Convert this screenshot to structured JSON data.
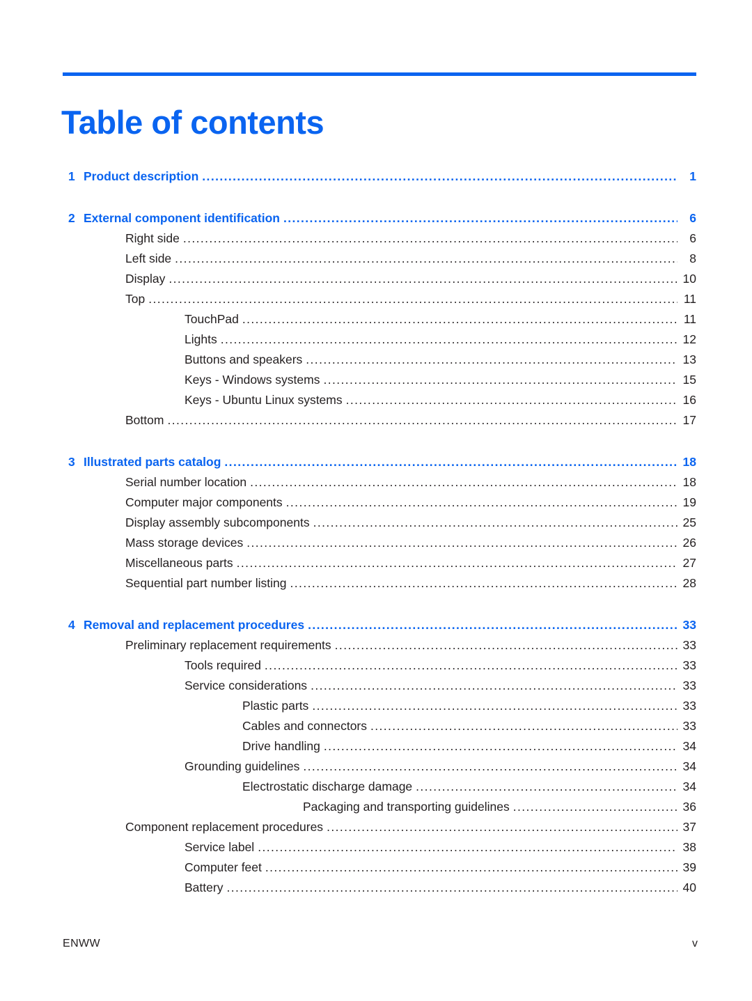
{
  "document": {
    "title": "Table of contents",
    "accent_color": "#0a64f0",
    "text_color": "#231f20",
    "leader_char": "."
  },
  "footer": {
    "left_label": "ENWW",
    "page_number": "v"
  },
  "toc": {
    "entries": [
      {
        "level": 1,
        "number": "1",
        "label": "Product description",
        "page": "1",
        "gap_before": false
      },
      {
        "level": 1,
        "number": "2",
        "label": "External component identification",
        "page": "6",
        "gap_before": true
      },
      {
        "level": 2,
        "number": "",
        "label": "Right side",
        "page": "6",
        "gap_before": false
      },
      {
        "level": 2,
        "number": "",
        "label": "Left side",
        "page": "8",
        "gap_before": false
      },
      {
        "level": 2,
        "number": "",
        "label": "Display",
        "page": "10",
        "gap_before": false
      },
      {
        "level": 2,
        "number": "",
        "label": "Top",
        "page": "11",
        "gap_before": false
      },
      {
        "level": 3,
        "number": "",
        "label": "TouchPad",
        "page": "11",
        "gap_before": false
      },
      {
        "level": 3,
        "number": "",
        "label": "Lights",
        "page": "12",
        "gap_before": false
      },
      {
        "level": 3,
        "number": "",
        "label": "Buttons and speakers",
        "page": "13",
        "gap_before": false
      },
      {
        "level": 3,
        "number": "",
        "label": "Keys - Windows systems",
        "page": "15",
        "gap_before": false
      },
      {
        "level": 3,
        "number": "",
        "label": "Keys - Ubuntu Linux systems",
        "page": "16",
        "gap_before": false
      },
      {
        "level": 2,
        "number": "",
        "label": "Bottom",
        "page": "17",
        "gap_before": false
      },
      {
        "level": 1,
        "number": "3",
        "label": "Illustrated parts catalog",
        "page": "18",
        "gap_before": true
      },
      {
        "level": 2,
        "number": "",
        "label": "Serial number location",
        "page": "18",
        "gap_before": false
      },
      {
        "level": 2,
        "number": "",
        "label": "Computer major components",
        "page": "19",
        "gap_before": false
      },
      {
        "level": 2,
        "number": "",
        "label": "Display assembly subcomponents",
        "page": "25",
        "gap_before": false
      },
      {
        "level": 2,
        "number": "",
        "label": "Mass storage devices",
        "page": "26",
        "gap_before": false
      },
      {
        "level": 2,
        "number": "",
        "label": "Miscellaneous parts",
        "page": "27",
        "gap_before": false
      },
      {
        "level": 2,
        "number": "",
        "label": "Sequential part number listing",
        "page": "28",
        "gap_before": false
      },
      {
        "level": 1,
        "number": "4",
        "label": "Removal and replacement procedures",
        "page": "33",
        "gap_before": true
      },
      {
        "level": 2,
        "number": "",
        "label": "Preliminary replacement requirements",
        "page": "33",
        "gap_before": false
      },
      {
        "level": 3,
        "number": "",
        "label": "Tools required",
        "page": "33",
        "gap_before": false
      },
      {
        "level": 3,
        "number": "",
        "label": "Service considerations",
        "page": "33",
        "gap_before": false
      },
      {
        "level": 4,
        "number": "",
        "label": "Plastic parts",
        "page": "33",
        "gap_before": false
      },
      {
        "level": 4,
        "number": "",
        "label": "Cables and connectors",
        "page": "33",
        "gap_before": false
      },
      {
        "level": 4,
        "number": "",
        "label": "Drive handling",
        "page": "34",
        "gap_before": false
      },
      {
        "level": 3,
        "number": "",
        "label": "Grounding guidelines",
        "page": "34",
        "gap_before": false
      },
      {
        "level": 4,
        "number": "",
        "label": "Electrostatic discharge damage",
        "page": "34",
        "gap_before": false
      },
      {
        "level": 5,
        "number": "",
        "label": "Packaging and transporting guidelines",
        "page": "36",
        "gap_before": false
      },
      {
        "level": 2,
        "number": "",
        "label": "Component replacement procedures",
        "page": "37",
        "gap_before": false
      },
      {
        "level": 3,
        "number": "",
        "label": "Service label",
        "page": "38",
        "gap_before": false
      },
      {
        "level": 3,
        "number": "",
        "label": "Computer feet",
        "page": "39",
        "gap_before": false
      },
      {
        "level": 3,
        "number": "",
        "label": "Battery",
        "page": "40",
        "gap_before": false
      }
    ]
  }
}
